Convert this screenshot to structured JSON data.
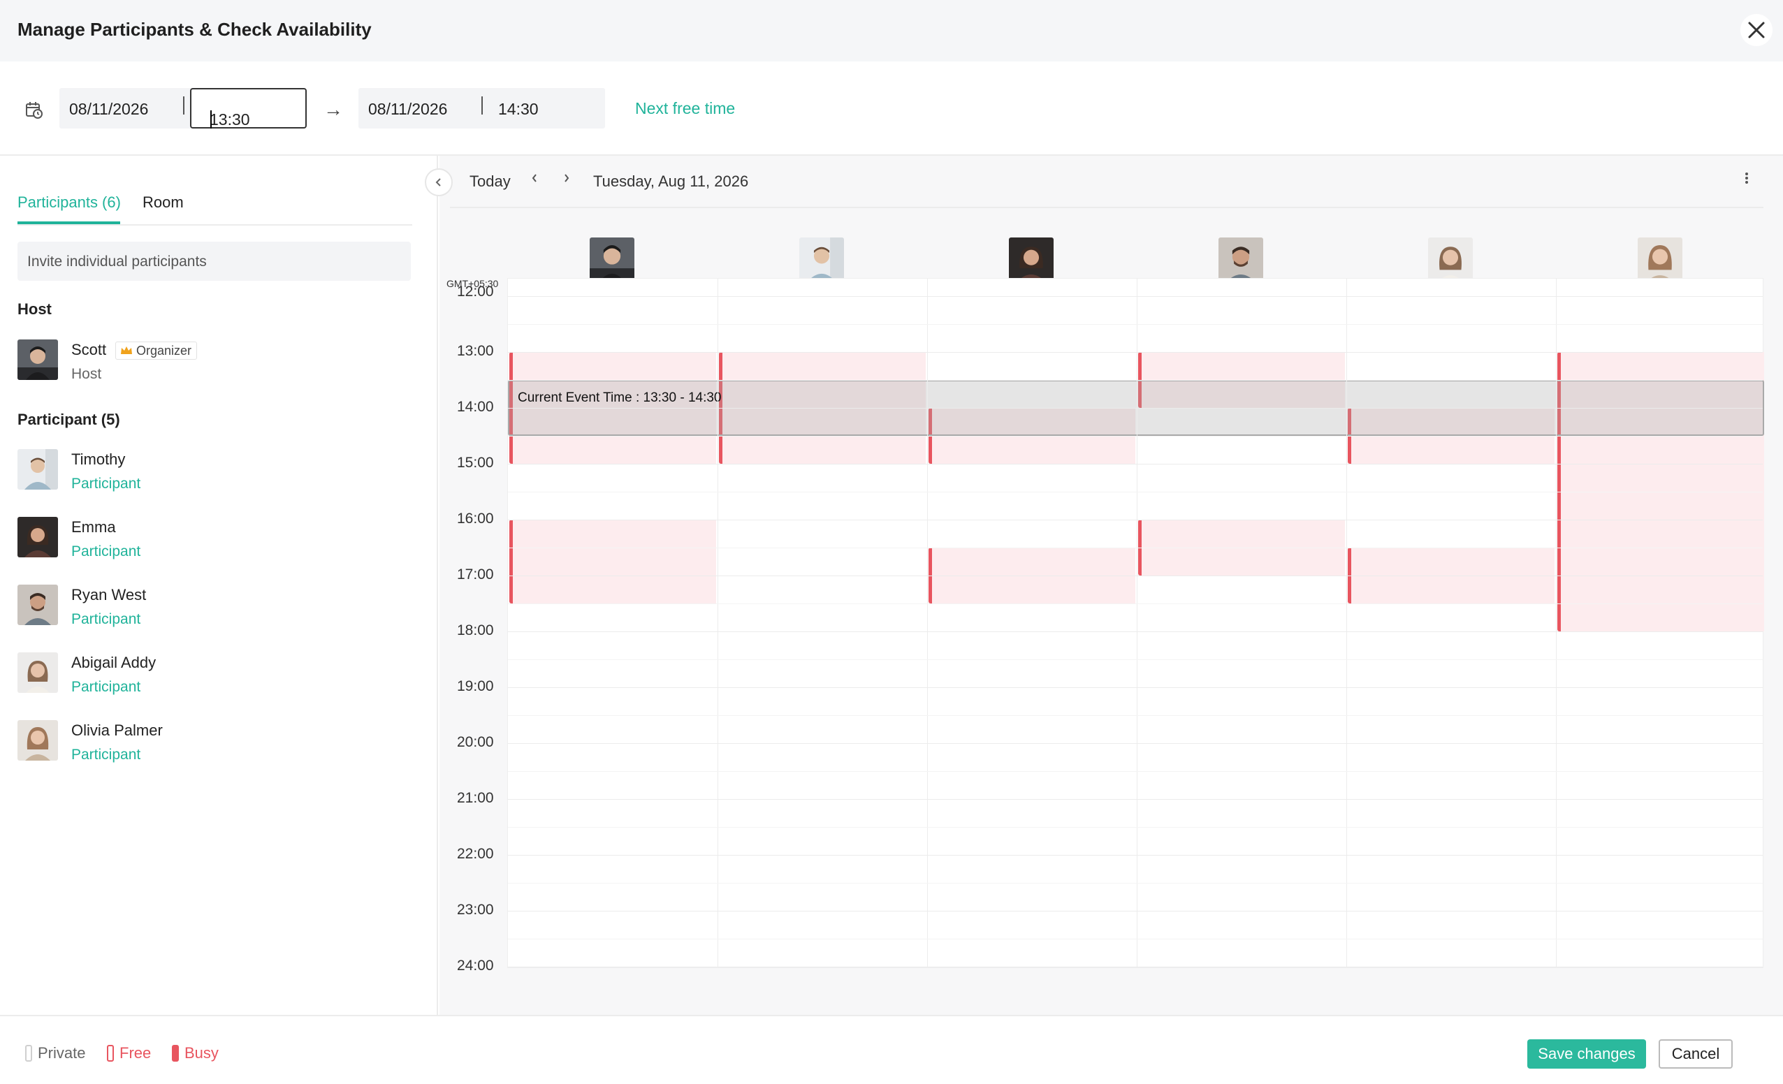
{
  "dialog": {
    "title": "Manage Participants & Check Availability"
  },
  "schedule": {
    "start_date": "08/11/2026",
    "start_time": "13:30",
    "end_date": "08/11/2026",
    "end_time": "14:30",
    "next_free_label": "Next free time"
  },
  "tabs": {
    "participants": "Participants (6)",
    "room": "Room"
  },
  "invite": {
    "placeholder": "Invite individual participants"
  },
  "host_section": {
    "heading": "Host",
    "name": "Scott",
    "badge": "Organizer",
    "role": "Host"
  },
  "participant_section": {
    "heading": "Participant (5)",
    "items": [
      {
        "name": "Timothy",
        "role": "Participant"
      },
      {
        "name": "Emma",
        "role": "Participant"
      },
      {
        "name": "Ryan West",
        "role": "Participant"
      },
      {
        "name": "Abigail Addy",
        "role": "Participant"
      },
      {
        "name": "Olivia Palmer",
        "role": "Participant"
      }
    ]
  },
  "calendar": {
    "today_label": "Today",
    "date_label": "Tuesday, Aug 11, 2026",
    "timezone": "GMT+05:30",
    "hours": [
      "12:00",
      "13:00",
      "14:00",
      "15:00",
      "16:00",
      "17:00",
      "18:00",
      "19:00",
      "20:00",
      "21:00",
      "22:00",
      "23:00",
      "24:00"
    ],
    "current_event_label": "Current Event Time : 13:30 - 14:30",
    "current_event": {
      "start": 13.5,
      "end": 14.5
    },
    "busy": [
      {
        "col": 0,
        "start": 13.0,
        "end": 15.0
      },
      {
        "col": 0,
        "start": 16.0,
        "end": 17.5
      },
      {
        "col": 1,
        "start": 13.0,
        "end": 15.0
      },
      {
        "col": 2,
        "start": 14.0,
        "end": 15.0
      },
      {
        "col": 2,
        "start": 16.5,
        "end": 17.5
      },
      {
        "col": 3,
        "start": 13.0,
        "end": 14.0
      },
      {
        "col": 3,
        "start": 16.0,
        "end": 17.0
      },
      {
        "col": 4,
        "start": 14.0,
        "end": 15.0
      },
      {
        "col": 4,
        "start": 16.5,
        "end": 17.5
      },
      {
        "col": 5,
        "start": 13.0,
        "end": 18.0
      }
    ]
  },
  "legend": {
    "private": "Private",
    "free": "Free",
    "busy": "Busy"
  },
  "colors": {
    "accent": "#20b39a",
    "busy": "#e8555f",
    "busy_fill": "#fdecee"
  },
  "footer": {
    "save_label": "Save changes",
    "cancel_label": "Cancel"
  }
}
